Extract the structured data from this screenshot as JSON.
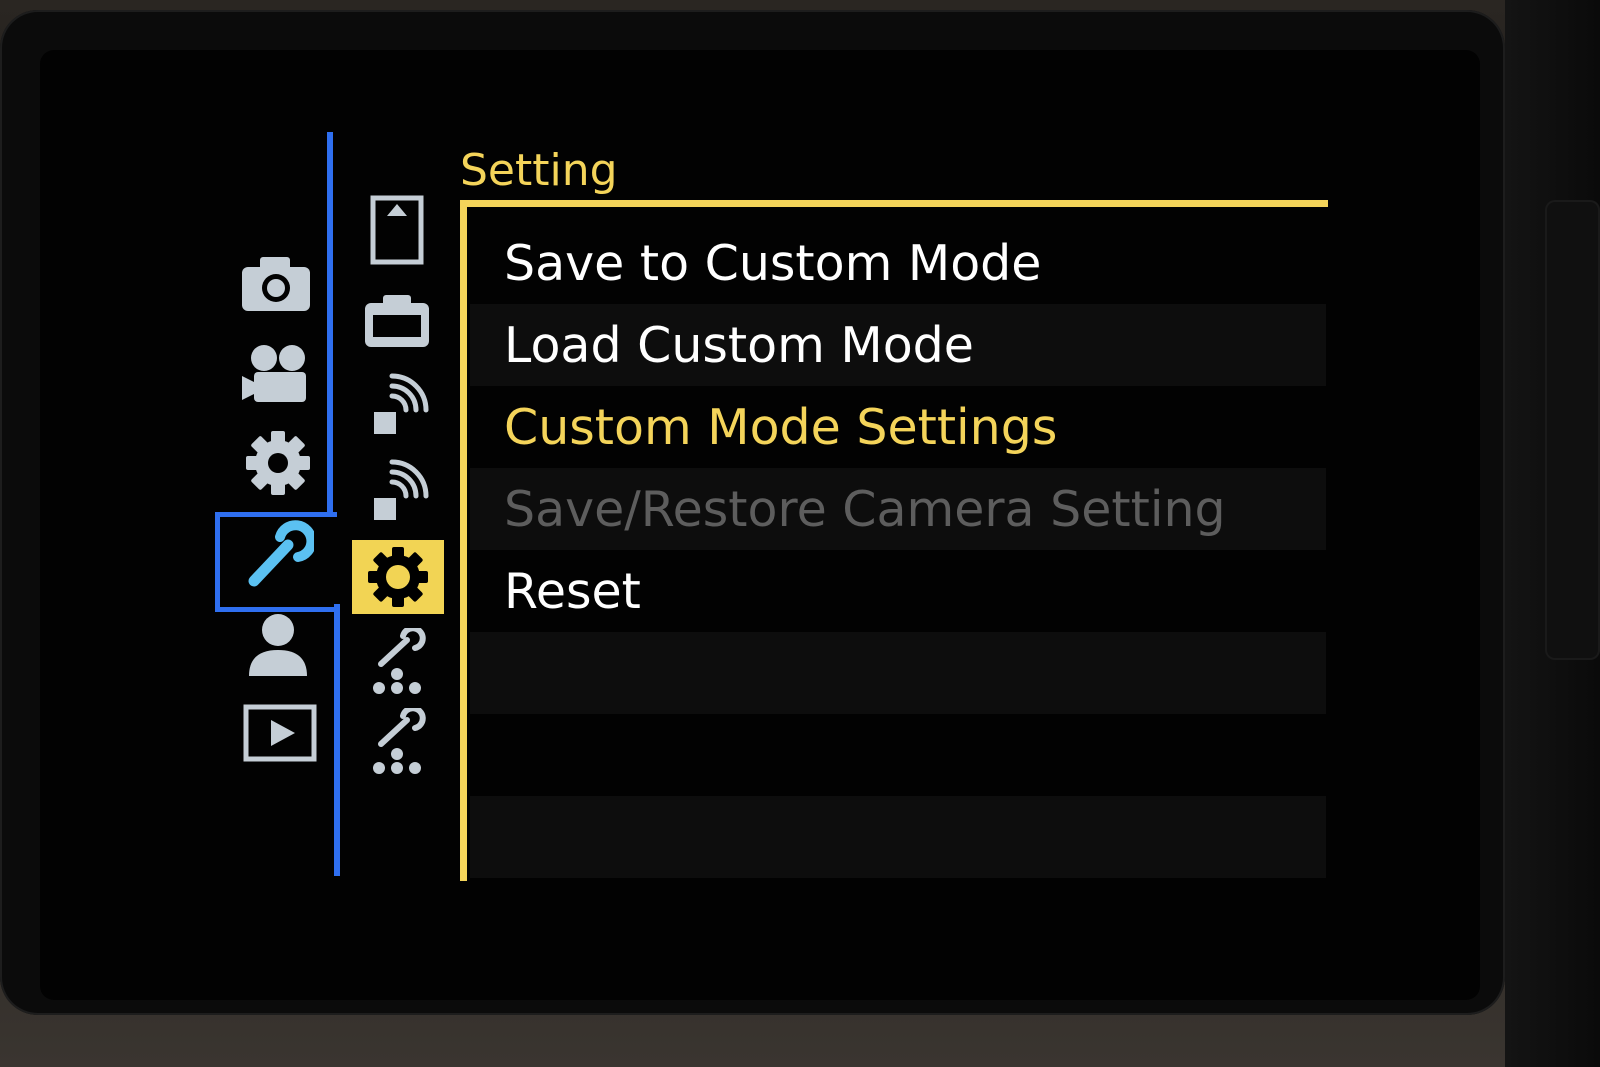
{
  "menu": {
    "title": "Setting",
    "items": [
      {
        "label": "Save to Custom Mode",
        "state": "normal"
      },
      {
        "label": "Load Custom Mode",
        "state": "normal"
      },
      {
        "label": "Custom Mode Settings",
        "state": "selected"
      },
      {
        "label": "Save/Restore Camera Setting",
        "state": "disabled"
      },
      {
        "label": "Reset",
        "state": "normal"
      }
    ]
  },
  "categories": [
    {
      "icon": "camera-icon"
    },
    {
      "icon": "movie-camera-icon"
    },
    {
      "icon": "gear-icon"
    },
    {
      "icon": "wrench-icon",
      "active": true
    },
    {
      "icon": "person-icon"
    },
    {
      "icon": "playback-icon"
    }
  ],
  "sub_tabs": [
    {
      "icon": "card-slot-icon"
    },
    {
      "icon": "monitor-icon"
    },
    {
      "icon": "wireless-icon"
    },
    {
      "icon": "wireless-icon"
    },
    {
      "icon": "gear-icon",
      "active": true
    },
    {
      "icon": "setup-custom-icon"
    },
    {
      "icon": "setup-custom-icon"
    }
  ],
  "colors": {
    "accent_yellow": "#f4d45a",
    "accent_blue": "#2f6ff0",
    "icon_gray": "#c5ced6",
    "disabled_text": "#5d5d5d"
  }
}
